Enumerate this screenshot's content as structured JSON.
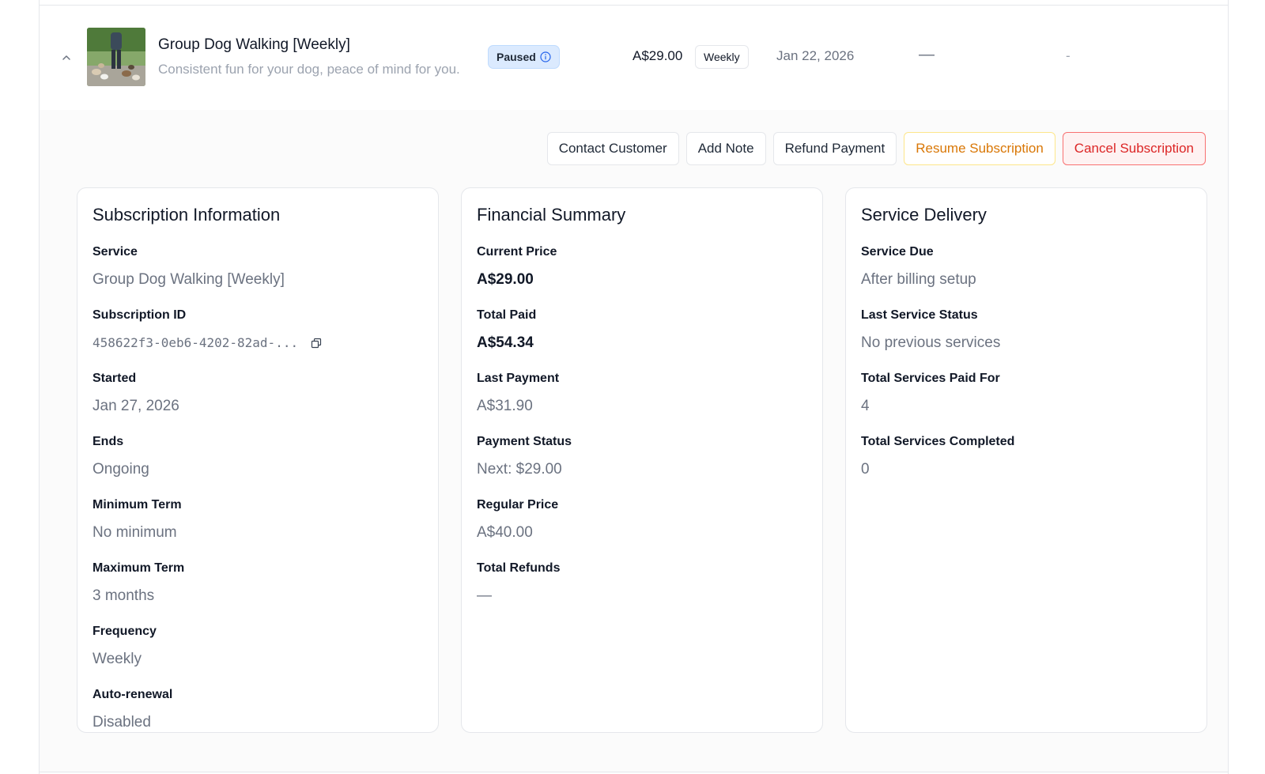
{
  "row": {
    "service_title": "Group Dog Walking [Weekly]",
    "service_description": "Consistent fun for your dog, peace of mind for you.",
    "status": "Paused",
    "price": "A$29.00",
    "frequency": "Weekly",
    "next_date": "Jan 22, 2026",
    "col_a": "—",
    "col_b": "-",
    "icons": {
      "collapse": "chevron-up-icon",
      "thumbnail": "dog-walking-photo",
      "status_info": "info-icon"
    }
  },
  "actions": {
    "contact": "Contact Customer",
    "add_note": "Add Note",
    "refund": "Refund Payment",
    "resume": "Resume Subscription",
    "cancel": "Cancel Subscription"
  },
  "subscription_info": {
    "title": "Subscription Information",
    "service_label": "Service",
    "service_value": "Group Dog Walking [Weekly]",
    "id_label": "Subscription ID",
    "id_value": "458622f3-0eb6-4202-82ad-...",
    "started_label": "Started",
    "started_value": "Jan 27, 2026",
    "ends_label": "Ends",
    "ends_value": "Ongoing",
    "min_term_label": "Minimum Term",
    "min_term_value": "No minimum",
    "max_term_label": "Maximum Term",
    "max_term_value": "3 months",
    "frequency_label": "Frequency",
    "frequency_value": "Weekly",
    "auto_renewal_label": "Auto-renewal",
    "auto_renewal_value": "Disabled"
  },
  "financial_summary": {
    "title": "Financial Summary",
    "current_price_label": "Current Price",
    "current_price_value": "A$29.00",
    "total_paid_label": "Total Paid",
    "total_paid_value": "A$54.34",
    "last_payment_label": "Last Payment",
    "last_payment_value": "A$31.90",
    "payment_status_label": "Payment Status",
    "payment_status_value": "Next: $29.00",
    "regular_price_label": "Regular Price",
    "regular_price_value": "A$40.00",
    "total_refunds_label": "Total Refunds",
    "total_refunds_value": "—"
  },
  "service_delivery": {
    "title": "Service Delivery",
    "service_due_label": "Service Due",
    "service_due_value": "After billing setup",
    "last_status_label": "Last Service Status",
    "last_status_value": "No previous services",
    "paid_for_label": "Total Services Paid For",
    "paid_for_value": "4",
    "completed_label": "Total Services Completed",
    "completed_value": "0"
  },
  "colors": {
    "paused_badge_bg": "#dbeafe",
    "resume_text": "#d97706",
    "cancel_text": "#dc2626",
    "cancel_border": "#f87171"
  }
}
